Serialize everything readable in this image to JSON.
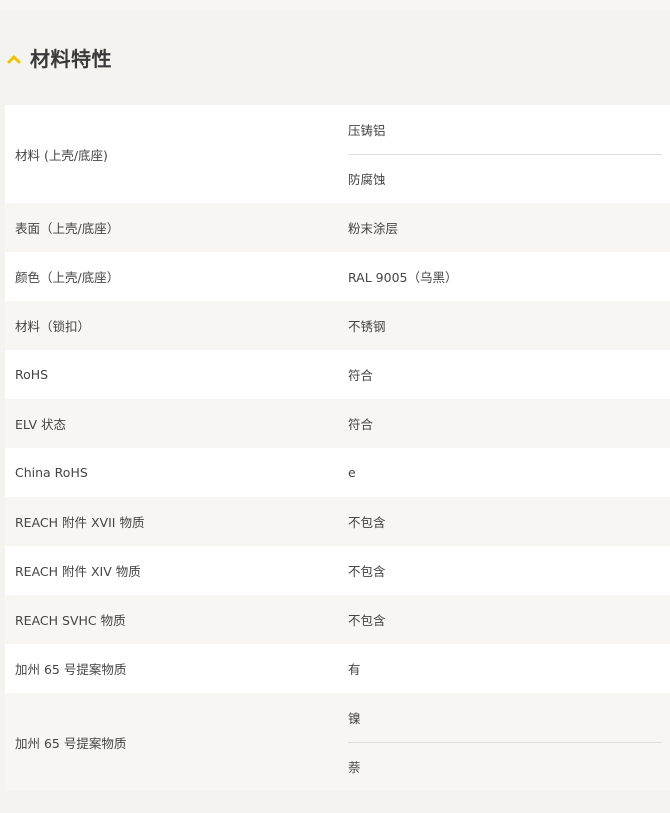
{
  "section": {
    "title": "材料特性",
    "icon": "chevron-up-icon",
    "accent_color": "#f2c200"
  },
  "rows": [
    {
      "label": "材料 (上壳/底座)",
      "values": [
        "压铸铝",
        "防腐蚀"
      ]
    },
    {
      "label": "表面（上壳/底座）",
      "values": [
        "粉末涂层"
      ]
    },
    {
      "label": "颜色（上壳/底座）",
      "values": [
        "RAL 9005（乌黑）"
      ]
    },
    {
      "label": "材料（锁扣）",
      "values": [
        "不锈钢"
      ]
    },
    {
      "label": "RoHS",
      "values": [
        "符合"
      ]
    },
    {
      "label": "ELV 状态",
      "values": [
        "符合"
      ]
    },
    {
      "label": "China RoHS",
      "values": [
        "e"
      ]
    },
    {
      "label": "REACH 附件 XVII 物质",
      "values": [
        "不包含"
      ]
    },
    {
      "label": "REACH 附件 XIV 物质",
      "values": [
        "不包含"
      ]
    },
    {
      "label": "REACH SVHC 物质",
      "values": [
        "不包含"
      ]
    },
    {
      "label": "加州 65 号提案物质",
      "values": [
        "有"
      ]
    },
    {
      "label": "加州 65 号提案物质",
      "values": [
        "镍",
        "萘"
      ]
    }
  ]
}
